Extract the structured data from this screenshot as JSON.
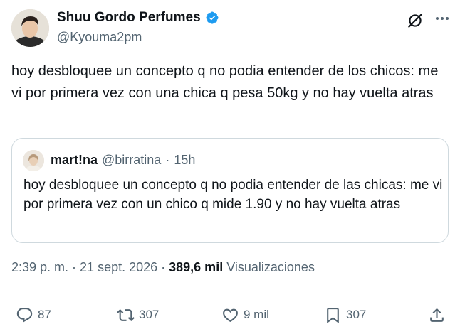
{
  "author": {
    "name": "Shuu Gordo Perfumes",
    "handle": "@Kyouma2pm",
    "verified": true,
    "verified_color": "#1d9bf0"
  },
  "tweet": {
    "text": "hoy desbloquee un concepto q no podia entender de los chicos: me vi por primera vez con una chica q pesa 50kg y no hay vuelta atras"
  },
  "quoted": {
    "name": "mart!na",
    "handle": "@birratina",
    "separator": "·",
    "time": "15h",
    "text": "hoy desbloquee un concepto q no podia entender de las chicas: me vi por primera vez con un chico q mide 1.90 y no hay vuelta atras"
  },
  "meta": {
    "time": "2:39 p. m.",
    "separator": "·",
    "date": "21 sept. 2026",
    "views_count": "389,6 mil",
    "views_label": "Visualizaciones"
  },
  "actions": {
    "replies": "87",
    "reposts": "307",
    "likes": "9 mil",
    "bookmarks": "307"
  },
  "icons": {
    "verified": "verified-badge-icon",
    "grok": "grok-icon",
    "more": "more-options-icon",
    "reply": "reply-icon",
    "repost": "repost-icon",
    "like": "heart-icon",
    "bookmark": "bookmark-icon",
    "share": "share-icon"
  },
  "colors": {
    "text": "#0f1419",
    "secondary": "#536471",
    "border": "#cfd9de",
    "accent": "#1d9bf0"
  }
}
